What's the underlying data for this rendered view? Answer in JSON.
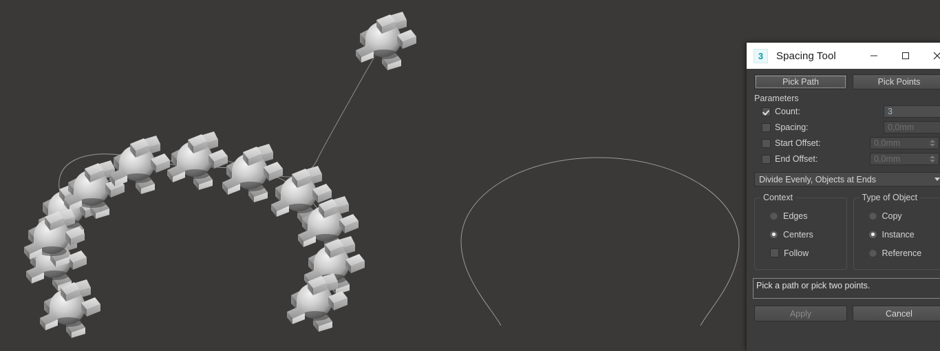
{
  "viewport": {
    "background_color": "#3b3937",
    "objects_description": "spheres-with-box-protrusions",
    "object_count_on_arc": 14,
    "spline_color": "#9a9a9a"
  },
  "dialog": {
    "title": "Spacing Tool",
    "app_icon_label": "3",
    "window_controls": {
      "minimize": "minimize-icon",
      "maximize": "maximize-icon",
      "close": "close-icon"
    },
    "pick_path_label": "Pick Path",
    "pick_points_label": "Pick Points",
    "parameters": {
      "group_label": "Parameters",
      "rows": [
        {
          "label": "Count:",
          "checked": true,
          "value": "3",
          "enabled": true,
          "lock": false
        },
        {
          "label": "Spacing:",
          "checked": false,
          "value": "0,0mm",
          "enabled": false,
          "lock": false
        },
        {
          "label": "Start Offset:",
          "checked": false,
          "value": "0,0mm",
          "enabled": false,
          "lock": true
        },
        {
          "label": "End Offset:",
          "checked": false,
          "value": "0,0mm",
          "enabled": false,
          "lock": true
        }
      ],
      "distribution": "Divide Evenly, Objects at Ends"
    },
    "context": {
      "group_label": "Context",
      "edges_label": "Edges",
      "centers_label": "Centers",
      "follow_label": "Follow",
      "selected": "Centers",
      "follow_checked": false
    },
    "type_of_object": {
      "group_label": "Type of Object",
      "copy_label": "Copy",
      "instance_label": "Instance",
      "reference_label": "Reference",
      "selected": "Instance"
    },
    "status_text": "Pick a path or pick two points.",
    "apply_label": "Apply",
    "apply_enabled": false,
    "cancel_label": "Cancel",
    "accent_colors": {
      "app_icon": "#0b9ba8",
      "lock_icon": "#2b37b8",
      "active_value_text": "#9fb6c9"
    }
  }
}
